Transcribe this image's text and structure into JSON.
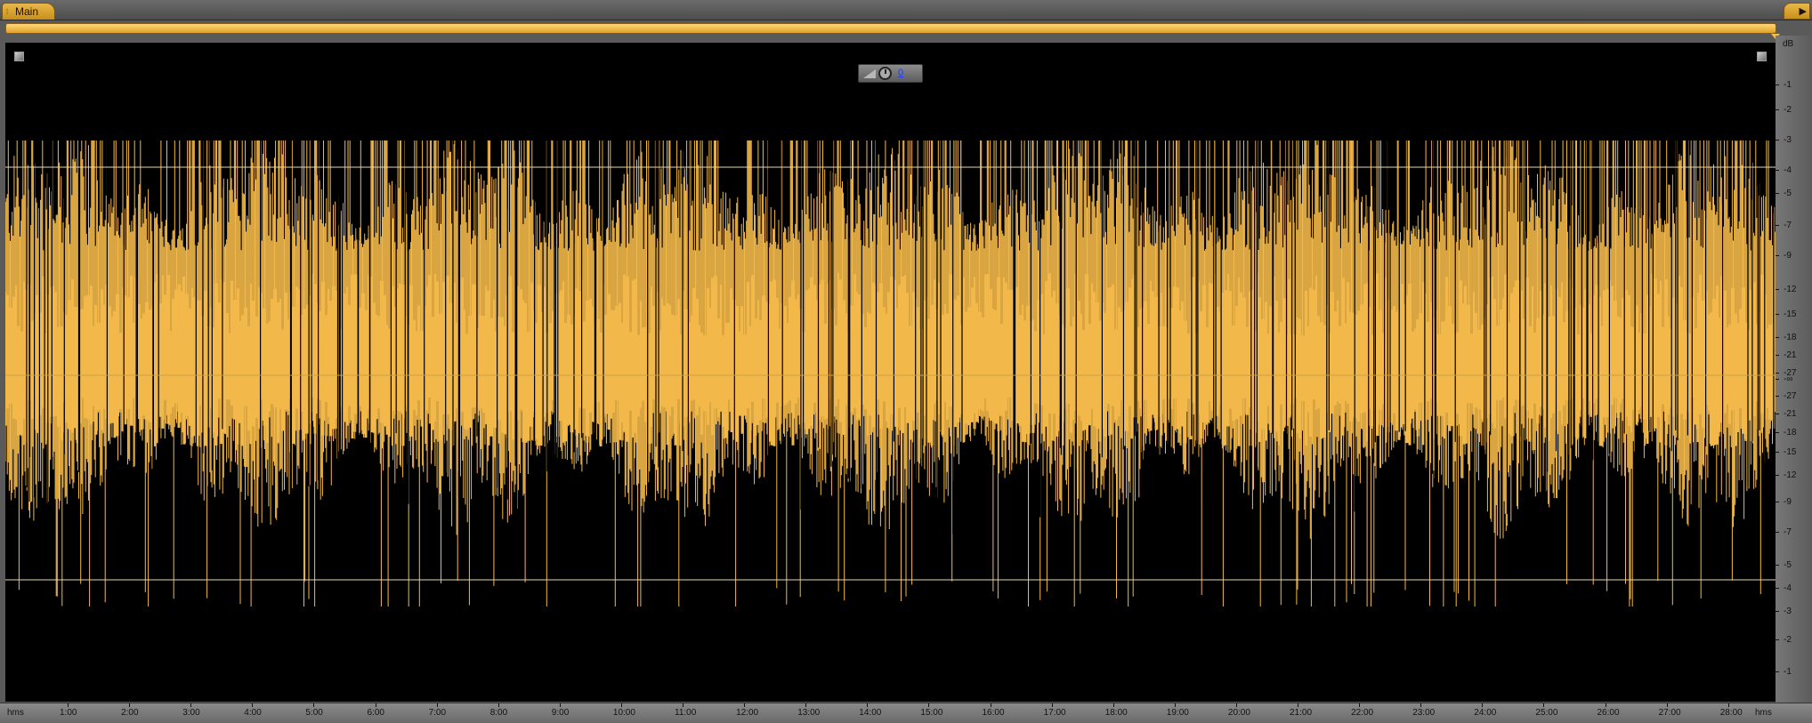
{
  "tab": {
    "label": "Main"
  },
  "hud": {
    "value": "0"
  },
  "colors": {
    "waveform": "#f2b84a",
    "background": "#000000",
    "accent": "#e0a12b"
  },
  "db_axis": {
    "unit": "dB",
    "top_half": [
      "-1",
      "-2",
      "-3",
      "-4",
      "-5",
      "-7",
      "-9",
      "-12",
      "-15",
      "-18",
      "-21",
      "-27"
    ],
    "center": "-∞",
    "bottom_half": [
      "-27",
      "-21",
      "-18",
      "-15",
      "-12",
      "-9",
      "-7",
      "-5",
      "-4",
      "-3",
      "-2",
      "-1"
    ]
  },
  "time_axis": {
    "unit_left": "hms",
    "unit_right": "hms",
    "labels": [
      "1:00",
      "2:00",
      "3:00",
      "4:00",
      "5:00",
      "6:00",
      "7:00",
      "8:00",
      "9:00",
      "10:00",
      "11:00",
      "12:00",
      "13:00",
      "14:00",
      "15:00",
      "16:00",
      "17:00",
      "18:00",
      "19:00",
      "20:00",
      "21:00",
      "22:00",
      "23:00",
      "24:00",
      "25:00",
      "26:00",
      "27:00",
      "28:00"
    ]
  }
}
